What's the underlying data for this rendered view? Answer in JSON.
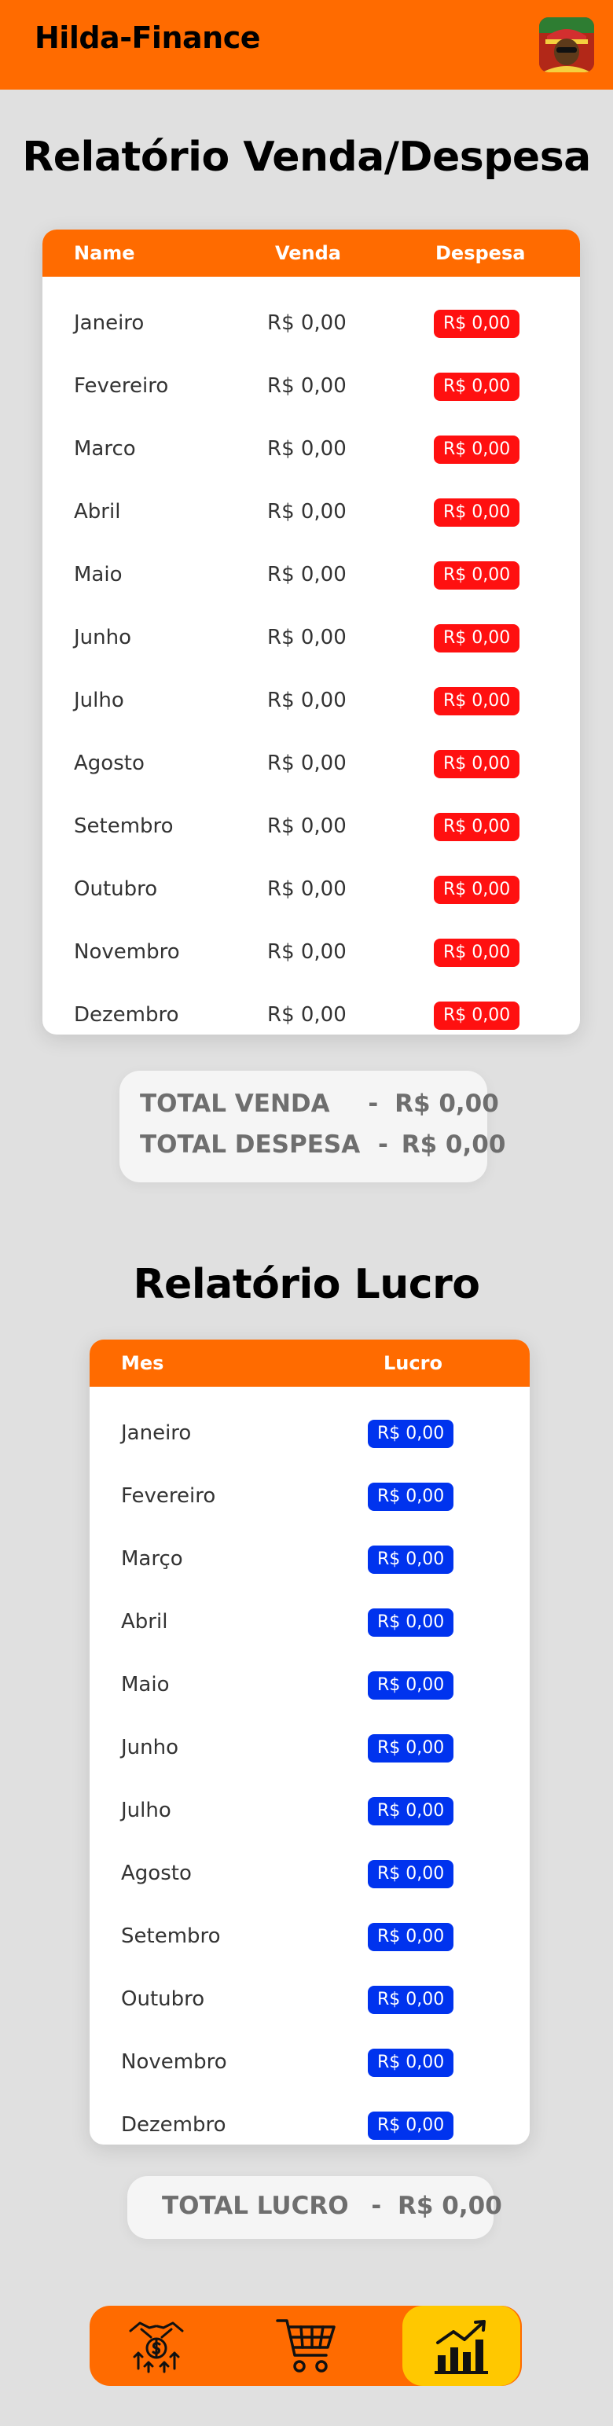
{
  "app": {
    "title": "Hilda-Finance"
  },
  "vendas": {
    "title": "Relatório Venda/Despesa",
    "columns": [
      "Name",
      "Venda",
      "Despesa"
    ],
    "rows": [
      {
        "name": "Janeiro",
        "venda": "R$ 0,00",
        "despesa": "R$ 0,00"
      },
      {
        "name": "Fevereiro",
        "venda": "R$ 0,00",
        "despesa": "R$ 0,00"
      },
      {
        "name": "Marco",
        "venda": "R$ 0,00",
        "despesa": "R$ 0,00"
      },
      {
        "name": "Abril",
        "venda": "R$ 0,00",
        "despesa": "R$ 0,00"
      },
      {
        "name": "Maio",
        "venda": "R$ 0,00",
        "despesa": "R$ 0,00"
      },
      {
        "name": "Junho",
        "venda": "R$ 0,00",
        "despesa": "R$ 0,00"
      },
      {
        "name": "Julho",
        "venda": "R$ 0,00",
        "despesa": "R$ 0,00"
      },
      {
        "name": "Agosto",
        "venda": "R$ 0,00",
        "despesa": "R$ 0,00"
      },
      {
        "name": "Setembro",
        "venda": "R$ 0,00",
        "despesa": "R$ 0,00"
      },
      {
        "name": "Outubro",
        "venda": "R$ 0,00",
        "despesa": "R$ 0,00"
      },
      {
        "name": "Novembro",
        "venda": "R$ 0,00",
        "despesa": "R$ 0,00"
      },
      {
        "name": "Dezembro",
        "venda": "R$ 0,00",
        "despesa": "R$ 0,00"
      }
    ],
    "total_venda_label": "TOTAL VENDA",
    "total_venda_value": "R$ 0,00",
    "total_despesa_label": "TOTAL DESPESA",
    "total_despesa_value": "R$ 0,00",
    "separator": "-"
  },
  "lucro": {
    "title": "Relatório Lucro",
    "columns": [
      "Mes",
      "Lucro"
    ],
    "rows": [
      {
        "mes": "Janeiro",
        "lucro": "R$ 0,00"
      },
      {
        "mes": "Fevereiro",
        "lucro": "R$ 0,00"
      },
      {
        "mes": "Março",
        "lucro": "R$ 0,00"
      },
      {
        "mes": "Abril",
        "lucro": "R$ 0,00"
      },
      {
        "mes": "Maio",
        "lucro": "R$ 0,00"
      },
      {
        "mes": "Junho",
        "lucro": "R$ 0,00"
      },
      {
        "mes": "Julho",
        "lucro": "R$ 0,00"
      },
      {
        "mes": "Agosto",
        "lucro": "R$ 0,00"
      },
      {
        "mes": "Setembro",
        "lucro": "R$ 0,00"
      },
      {
        "mes": "Outubro",
        "lucro": "R$ 0,00"
      },
      {
        "mes": "Novembro",
        "lucro": "R$ 0,00"
      },
      {
        "mes": "Dezembro",
        "lucro": "R$ 0,00"
      }
    ],
    "total_label": "TOTAL LUCRO",
    "total_value": "R$ 0,00",
    "separator": "-"
  },
  "nav": {
    "items": [
      {
        "icon": "money-hand-icon",
        "active": false
      },
      {
        "icon": "shopping-cart-icon",
        "active": false
      },
      {
        "icon": "bar-chart-icon",
        "active": true
      }
    ]
  },
  "colors": {
    "brand": "#ff6b00",
    "active": "#ffc800",
    "despesa": "#ff1010",
    "lucro": "#0033ee",
    "background": "#e0e0e0"
  }
}
